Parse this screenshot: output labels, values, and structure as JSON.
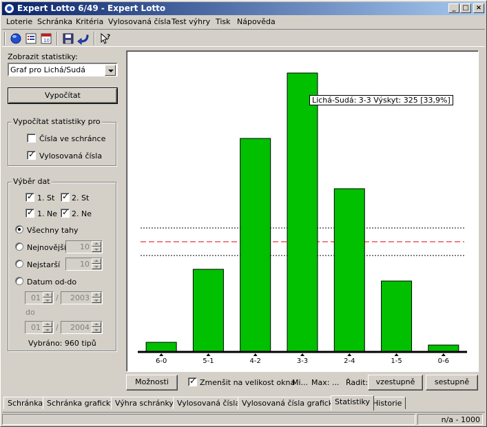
{
  "window": {
    "title": "Expert Lotto 6/49 - Expert Lotto"
  },
  "menu": [
    "Loterie",
    "Schránka",
    "Kritéria",
    "Vylosovaná čísla",
    "Test výhry",
    "Tisk",
    "Nápověda"
  ],
  "toolbar": {
    "icons": [
      "globe-icon",
      "list-icon",
      "calendar-icon",
      "save-icon",
      "return-arrow-icon",
      "help-pointer-icon"
    ]
  },
  "left": {
    "show_stats_label": "Zobrazit statistiky:",
    "stats_select_value": "Graf pro Lichá/Sudá",
    "calculate_button": "Vypočítat",
    "calc_for": {
      "title": "Vypočítat statistiky pro",
      "numbers_in_box": {
        "label": "Čísla ve schránce",
        "checked": false
      },
      "drawn_numbers": {
        "label": "Vylosovaná čísla",
        "checked": true
      }
    },
    "data_select": {
      "title": "Výběr dat",
      "checks": [
        {
          "label": "1. St",
          "checked": true
        },
        {
          "label": "2. St",
          "checked": true
        },
        {
          "label": "1. Ne",
          "checked": true
        },
        {
          "label": "2. Ne",
          "checked": true
        }
      ],
      "all_draws": "Všechny tahy",
      "newest": {
        "label": "Nejnovější",
        "value": "10"
      },
      "oldest": {
        "label": "Nejstarší",
        "value": "10"
      },
      "date_range": "Datum od-do",
      "from": {
        "day": "01",
        "year": "2003"
      },
      "to_label": "do",
      "to": {
        "day": "01",
        "year": "2004"
      },
      "separator": "/",
      "selected_summary": "Vybráno: 960 tipů"
    }
  },
  "chart_data": {
    "type": "bar",
    "title": "",
    "xlabel": "",
    "ylabel": "",
    "categories": [
      "6-0",
      "5-1",
      "4-2",
      "3-3",
      "2-4",
      "1-5",
      "0-6"
    ],
    "values": [
      14,
      120,
      310,
      405,
      237,
      103,
      10
    ],
    "ylim": [
      0,
      425
    ],
    "reference_lines": [
      {
        "value": 180,
        "style": "dotted",
        "color": "#000000"
      },
      {
        "value": 160,
        "style": "dashed",
        "color": "#e00000"
      },
      {
        "value": 140,
        "style": "dotted",
        "color": "#000000"
      }
    ],
    "bar_color": "#00c000",
    "tooltip": "Lichá-Sudá: 3-3 Výskyt: 325 [33,9%]"
  },
  "controls": {
    "options_button": "Možnosti",
    "shrink_checkbox": {
      "label": "Zmenšit na velikost okna",
      "checked": true
    },
    "min_label": "Mi...",
    "max_label": "Max: ...",
    "sort_label": "Řadit:",
    "asc_button": "vzestupně",
    "desc_button": "sestupně"
  },
  "tabs": [
    {
      "label": "Schránka",
      "active": false
    },
    {
      "label": "Schránka graficky",
      "active": false
    },
    {
      "label": "Výhra schránky",
      "active": false
    },
    {
      "label": "Vylosovaná čísla",
      "active": false
    },
    {
      "label": "Vylosovaná čísla graficky",
      "active": false
    },
    {
      "label": "Statistiky",
      "active": true
    },
    {
      "label": "Historie",
      "active": false
    }
  ],
  "status": {
    "right_text": "n/a - 1000"
  }
}
